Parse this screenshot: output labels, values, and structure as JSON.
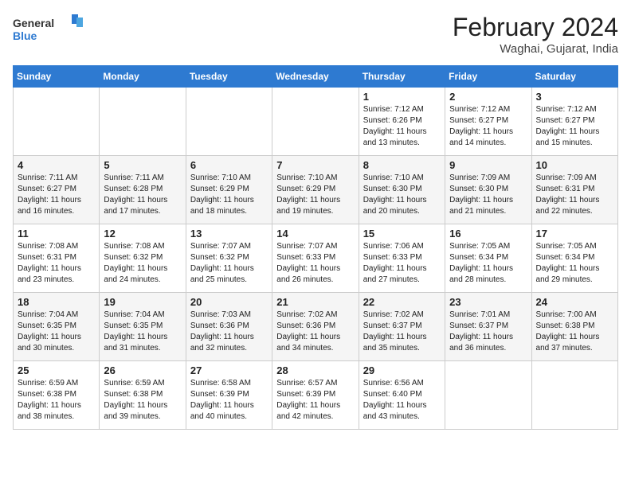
{
  "header": {
    "logo_general": "General",
    "logo_blue": "Blue",
    "title": "February 2024",
    "location": "Waghai, Gujarat, India"
  },
  "days_of_week": [
    "Sunday",
    "Monday",
    "Tuesday",
    "Wednesday",
    "Thursday",
    "Friday",
    "Saturday"
  ],
  "weeks": [
    [
      {
        "day": "",
        "info": ""
      },
      {
        "day": "",
        "info": ""
      },
      {
        "day": "",
        "info": ""
      },
      {
        "day": "",
        "info": ""
      },
      {
        "day": "1",
        "info": "Sunrise: 7:12 AM\nSunset: 6:26 PM\nDaylight: 11 hours and 13 minutes."
      },
      {
        "day": "2",
        "info": "Sunrise: 7:12 AM\nSunset: 6:27 PM\nDaylight: 11 hours and 14 minutes."
      },
      {
        "day": "3",
        "info": "Sunrise: 7:12 AM\nSunset: 6:27 PM\nDaylight: 11 hours and 15 minutes."
      }
    ],
    [
      {
        "day": "4",
        "info": "Sunrise: 7:11 AM\nSunset: 6:27 PM\nDaylight: 11 hours and 16 minutes."
      },
      {
        "day": "5",
        "info": "Sunrise: 7:11 AM\nSunset: 6:28 PM\nDaylight: 11 hours and 17 minutes."
      },
      {
        "day": "6",
        "info": "Sunrise: 7:10 AM\nSunset: 6:29 PM\nDaylight: 11 hours and 18 minutes."
      },
      {
        "day": "7",
        "info": "Sunrise: 7:10 AM\nSunset: 6:29 PM\nDaylight: 11 hours and 19 minutes."
      },
      {
        "day": "8",
        "info": "Sunrise: 7:10 AM\nSunset: 6:30 PM\nDaylight: 11 hours and 20 minutes."
      },
      {
        "day": "9",
        "info": "Sunrise: 7:09 AM\nSunset: 6:30 PM\nDaylight: 11 hours and 21 minutes."
      },
      {
        "day": "10",
        "info": "Sunrise: 7:09 AM\nSunset: 6:31 PM\nDaylight: 11 hours and 22 minutes."
      }
    ],
    [
      {
        "day": "11",
        "info": "Sunrise: 7:08 AM\nSunset: 6:31 PM\nDaylight: 11 hours and 23 minutes."
      },
      {
        "day": "12",
        "info": "Sunrise: 7:08 AM\nSunset: 6:32 PM\nDaylight: 11 hours and 24 minutes."
      },
      {
        "day": "13",
        "info": "Sunrise: 7:07 AM\nSunset: 6:32 PM\nDaylight: 11 hours and 25 minutes."
      },
      {
        "day": "14",
        "info": "Sunrise: 7:07 AM\nSunset: 6:33 PM\nDaylight: 11 hours and 26 minutes."
      },
      {
        "day": "15",
        "info": "Sunrise: 7:06 AM\nSunset: 6:33 PM\nDaylight: 11 hours and 27 minutes."
      },
      {
        "day": "16",
        "info": "Sunrise: 7:05 AM\nSunset: 6:34 PM\nDaylight: 11 hours and 28 minutes."
      },
      {
        "day": "17",
        "info": "Sunrise: 7:05 AM\nSunset: 6:34 PM\nDaylight: 11 hours and 29 minutes."
      }
    ],
    [
      {
        "day": "18",
        "info": "Sunrise: 7:04 AM\nSunset: 6:35 PM\nDaylight: 11 hours and 30 minutes."
      },
      {
        "day": "19",
        "info": "Sunrise: 7:04 AM\nSunset: 6:35 PM\nDaylight: 11 hours and 31 minutes."
      },
      {
        "day": "20",
        "info": "Sunrise: 7:03 AM\nSunset: 6:36 PM\nDaylight: 11 hours and 32 minutes."
      },
      {
        "day": "21",
        "info": "Sunrise: 7:02 AM\nSunset: 6:36 PM\nDaylight: 11 hours and 34 minutes."
      },
      {
        "day": "22",
        "info": "Sunrise: 7:02 AM\nSunset: 6:37 PM\nDaylight: 11 hours and 35 minutes."
      },
      {
        "day": "23",
        "info": "Sunrise: 7:01 AM\nSunset: 6:37 PM\nDaylight: 11 hours and 36 minutes."
      },
      {
        "day": "24",
        "info": "Sunrise: 7:00 AM\nSunset: 6:38 PM\nDaylight: 11 hours and 37 minutes."
      }
    ],
    [
      {
        "day": "25",
        "info": "Sunrise: 6:59 AM\nSunset: 6:38 PM\nDaylight: 11 hours and 38 minutes."
      },
      {
        "day": "26",
        "info": "Sunrise: 6:59 AM\nSunset: 6:38 PM\nDaylight: 11 hours and 39 minutes."
      },
      {
        "day": "27",
        "info": "Sunrise: 6:58 AM\nSunset: 6:39 PM\nDaylight: 11 hours and 40 minutes."
      },
      {
        "day": "28",
        "info": "Sunrise: 6:57 AM\nSunset: 6:39 PM\nDaylight: 11 hours and 42 minutes."
      },
      {
        "day": "29",
        "info": "Sunrise: 6:56 AM\nSunset: 6:40 PM\nDaylight: 11 hours and 43 minutes."
      },
      {
        "day": "",
        "info": ""
      },
      {
        "day": "",
        "info": ""
      }
    ]
  ]
}
